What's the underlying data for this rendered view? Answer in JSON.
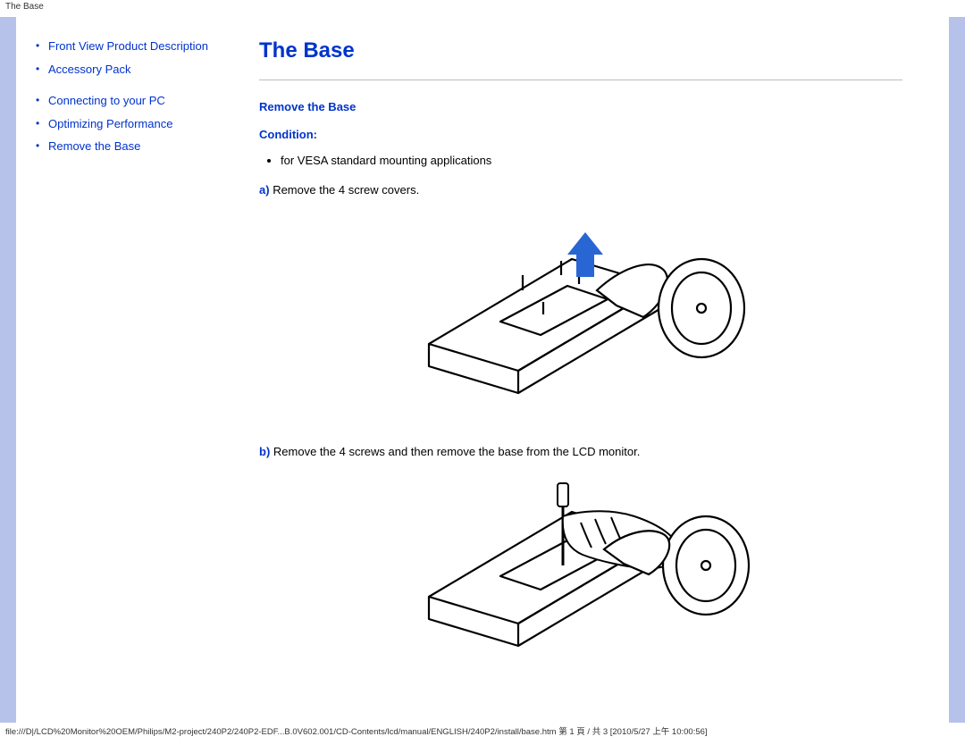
{
  "top_path_title": "The Base",
  "sidebar": {
    "group1": [
      {
        "label": "Front View Product Description"
      },
      {
        "label": "Accessory Pack"
      }
    ],
    "group2": [
      {
        "label": "Connecting to your PC"
      },
      {
        "label": "Optimizing Performance"
      },
      {
        "label": "Remove the Base"
      }
    ]
  },
  "content": {
    "title": "The Base",
    "section_title": "Remove the Base",
    "condition_label": "Condition:",
    "conditions": [
      "for VESA standard mounting applications"
    ],
    "steps": [
      {
        "id": "a)",
        "text": "Remove the 4 screw covers."
      },
      {
        "id": "b)",
        "text": "Remove the 4 screws and then remove the base from the LCD monitor."
      }
    ]
  },
  "status_line": "file:///D|/LCD%20Monitor%20OEM/Philips/M2-project/240P2/240P2-EDF...B.0V602.001/CD-Contents/lcd/manual/ENGLISH/240P2/install/base.htm 第 1 頁 / 共 3  [2010/5/27 上午 10:00:56]"
}
